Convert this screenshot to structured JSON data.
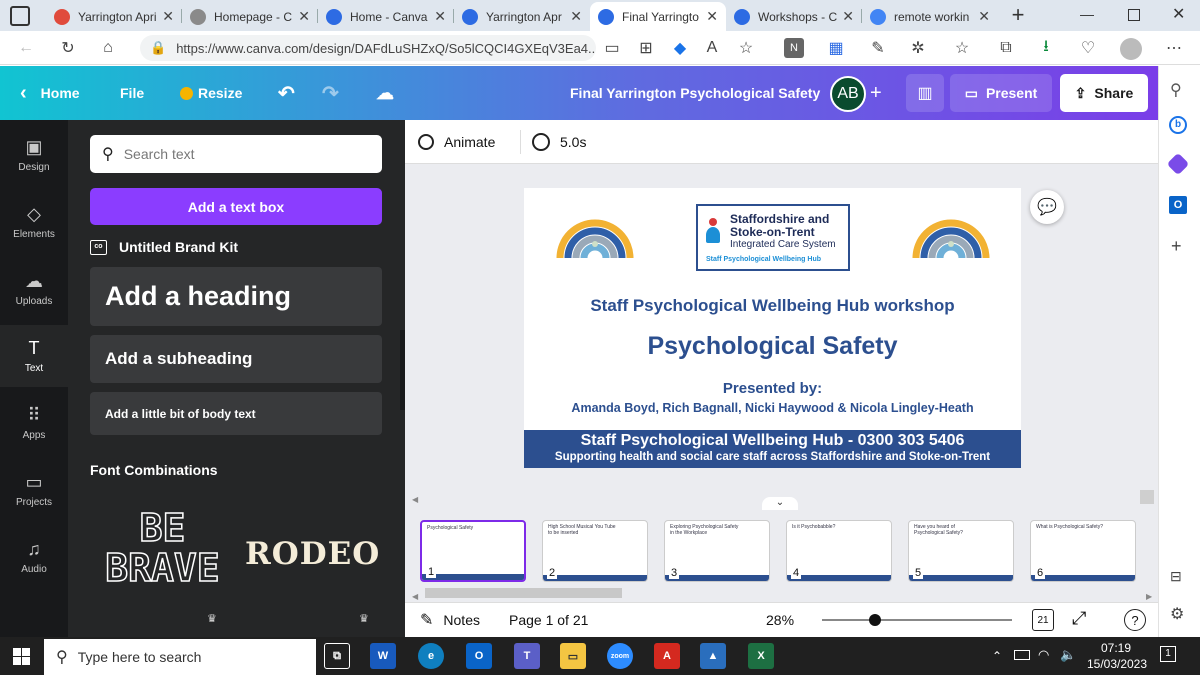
{
  "browser": {
    "tabs": [
      {
        "title": "Yarrington Apri",
        "icon": "pdf-icon",
        "color": "#e04b3c"
      },
      {
        "title": "Homepage - C",
        "icon": "page-icon",
        "color": "#8a8a8a"
      },
      {
        "title": "Home - Canva",
        "icon": "canva-icon",
        "color": "#2d6be3"
      },
      {
        "title": "Yarrington Apr",
        "icon": "canva-icon",
        "color": "#2d6be3"
      },
      {
        "title": "Final Yarringto",
        "icon": "canva-icon",
        "color": "#2d6be3"
      },
      {
        "title": "Workshops - C",
        "icon": "canva-icon",
        "color": "#2d6be3"
      },
      {
        "title": "remote workin",
        "icon": "google-icon",
        "color": "#4285f4"
      }
    ],
    "new_tab": "+",
    "url": "https://www.canva.com/design/DAFdLuSHZxQ/So5lCQCI4GXEqV3Ea4..."
  },
  "header": {
    "home": "Home",
    "file": "File",
    "resize": "Resize",
    "title": "Final Yarrington Psychological Safety",
    "avatar": "AB",
    "present": "Present",
    "share": "Share"
  },
  "rail": [
    {
      "label": "Design",
      "icon": "design-icon",
      "glyph": "▣"
    },
    {
      "label": "Elements",
      "icon": "elements-icon",
      "glyph": "◇"
    },
    {
      "label": "Uploads",
      "icon": "uploads-icon",
      "glyph": "☁"
    },
    {
      "label": "Text",
      "icon": "text-icon",
      "glyph": "T"
    },
    {
      "label": "Apps",
      "icon": "apps-icon",
      "glyph": "⠿"
    },
    {
      "label": "Projects",
      "icon": "projects-icon",
      "glyph": "▭"
    },
    {
      "label": "Audio",
      "icon": "audio-icon",
      "glyph": "♫"
    }
  ],
  "panel": {
    "search_placeholder": "Search text",
    "add_textbox": "Add a text box",
    "brand_kit": "Untitled Brand Kit",
    "heading": "Add a heading",
    "subheading": "Add a subheading",
    "body": "Add a little bit of body text",
    "font_combos": "Font Combinations",
    "combo1_line1": "BE",
    "combo1_line2": "BRAVE",
    "combo2": "RODEO"
  },
  "toolbar": {
    "animate": "Animate",
    "duration": "5.0s"
  },
  "slide": {
    "logo_line1": "Staffordshire and",
    "logo_line2": "Stoke-on-Trent",
    "logo_line3": "Integrated Care System",
    "logo_line4": "Staff Psychological Wellbeing Hub",
    "workshop": "Staff Psychological Wellbeing Hub workshop",
    "title": "Psychological Safety",
    "presented_by": "Presented by:",
    "presenters": "Amanda Boyd, Rich Bagnall, Nicki Haywood & Nicola Lingley-Heath",
    "footer1": "Staff Psychological Wellbeing Hub - 0300 303 5406",
    "footer2": "Supporting health and social care staff across Staffordshire and Stoke-on-Trent"
  },
  "thumbnails": [
    {
      "n": "1",
      "text": "Psychological Safety"
    },
    {
      "n": "2",
      "text": "High School Musical You Tube to be inserted"
    },
    {
      "n": "3",
      "text": "Exploring Psychological Safety in the Workplace"
    },
    {
      "n": "4",
      "text": "Is it Psychobabble?"
    },
    {
      "n": "5",
      "text": "Have you heard of Psychological Safety?"
    },
    {
      "n": "6",
      "text": "What is Psychological Safety?"
    }
  ],
  "bottombar": {
    "notes": "Notes",
    "page": "Page 1 of 21",
    "zoom": "28%",
    "grid_count": "21",
    "zoom_fraction": 0.28
  },
  "taskbar": {
    "search_placeholder": "Type here to search",
    "time": "07:19",
    "date": "15/03/2023",
    "notification_count": "1"
  },
  "colors": {
    "canva_purple": "#8b3dff",
    "slide_blue": "#2c4f8f",
    "taskbar": "#202020"
  }
}
